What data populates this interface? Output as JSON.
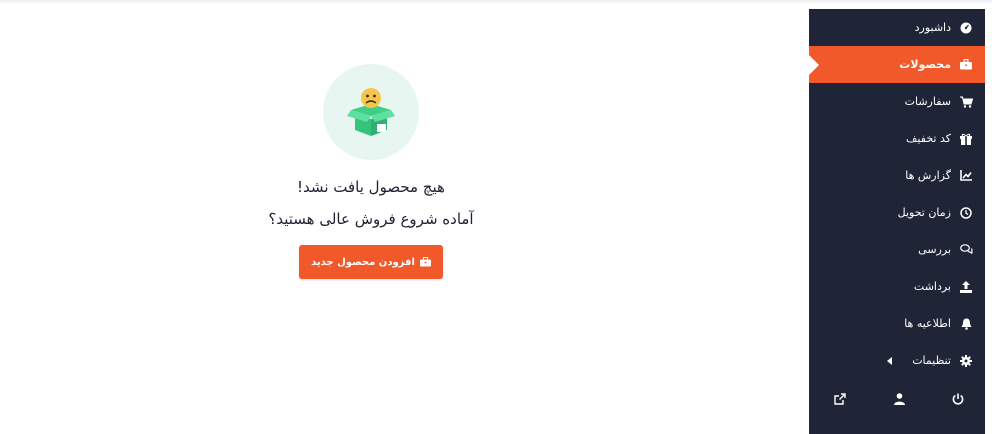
{
  "sidebar": {
    "items": [
      {
        "label": "داشبورد",
        "icon": "dashboard-icon",
        "active": false
      },
      {
        "label": "محصولات",
        "icon": "briefcase-icon",
        "active": true
      },
      {
        "label": "سفارشات",
        "icon": "cart-icon",
        "active": false
      },
      {
        "label": "کد تخفیف",
        "icon": "gift-icon",
        "active": false
      },
      {
        "label": "گزارش ها",
        "icon": "chart-icon",
        "active": false
      },
      {
        "label": "زمان تحویل",
        "icon": "clock-icon",
        "active": false
      },
      {
        "label": "بررسی",
        "icon": "comments-icon",
        "active": false
      },
      {
        "label": "برداشت",
        "icon": "upload-icon",
        "active": false
      },
      {
        "label": "اطلاعیه ها",
        "icon": "bell-icon",
        "active": false
      },
      {
        "label": "تنظیمات",
        "icon": "gear-icon",
        "active": false
      }
    ],
    "footer": [
      "power-icon",
      "user-icon",
      "external-link-icon"
    ]
  },
  "empty_state": {
    "title": "هیچ محصول یافت نشد!",
    "subtitle": "آماده شروع فروش عالی هستید؟",
    "button_label": "افزودن محصول جدید"
  },
  "colors": {
    "accent": "#f1582a",
    "sidebar_bg": "#1f2537",
    "illustration_bg": "#e7f6f1"
  }
}
